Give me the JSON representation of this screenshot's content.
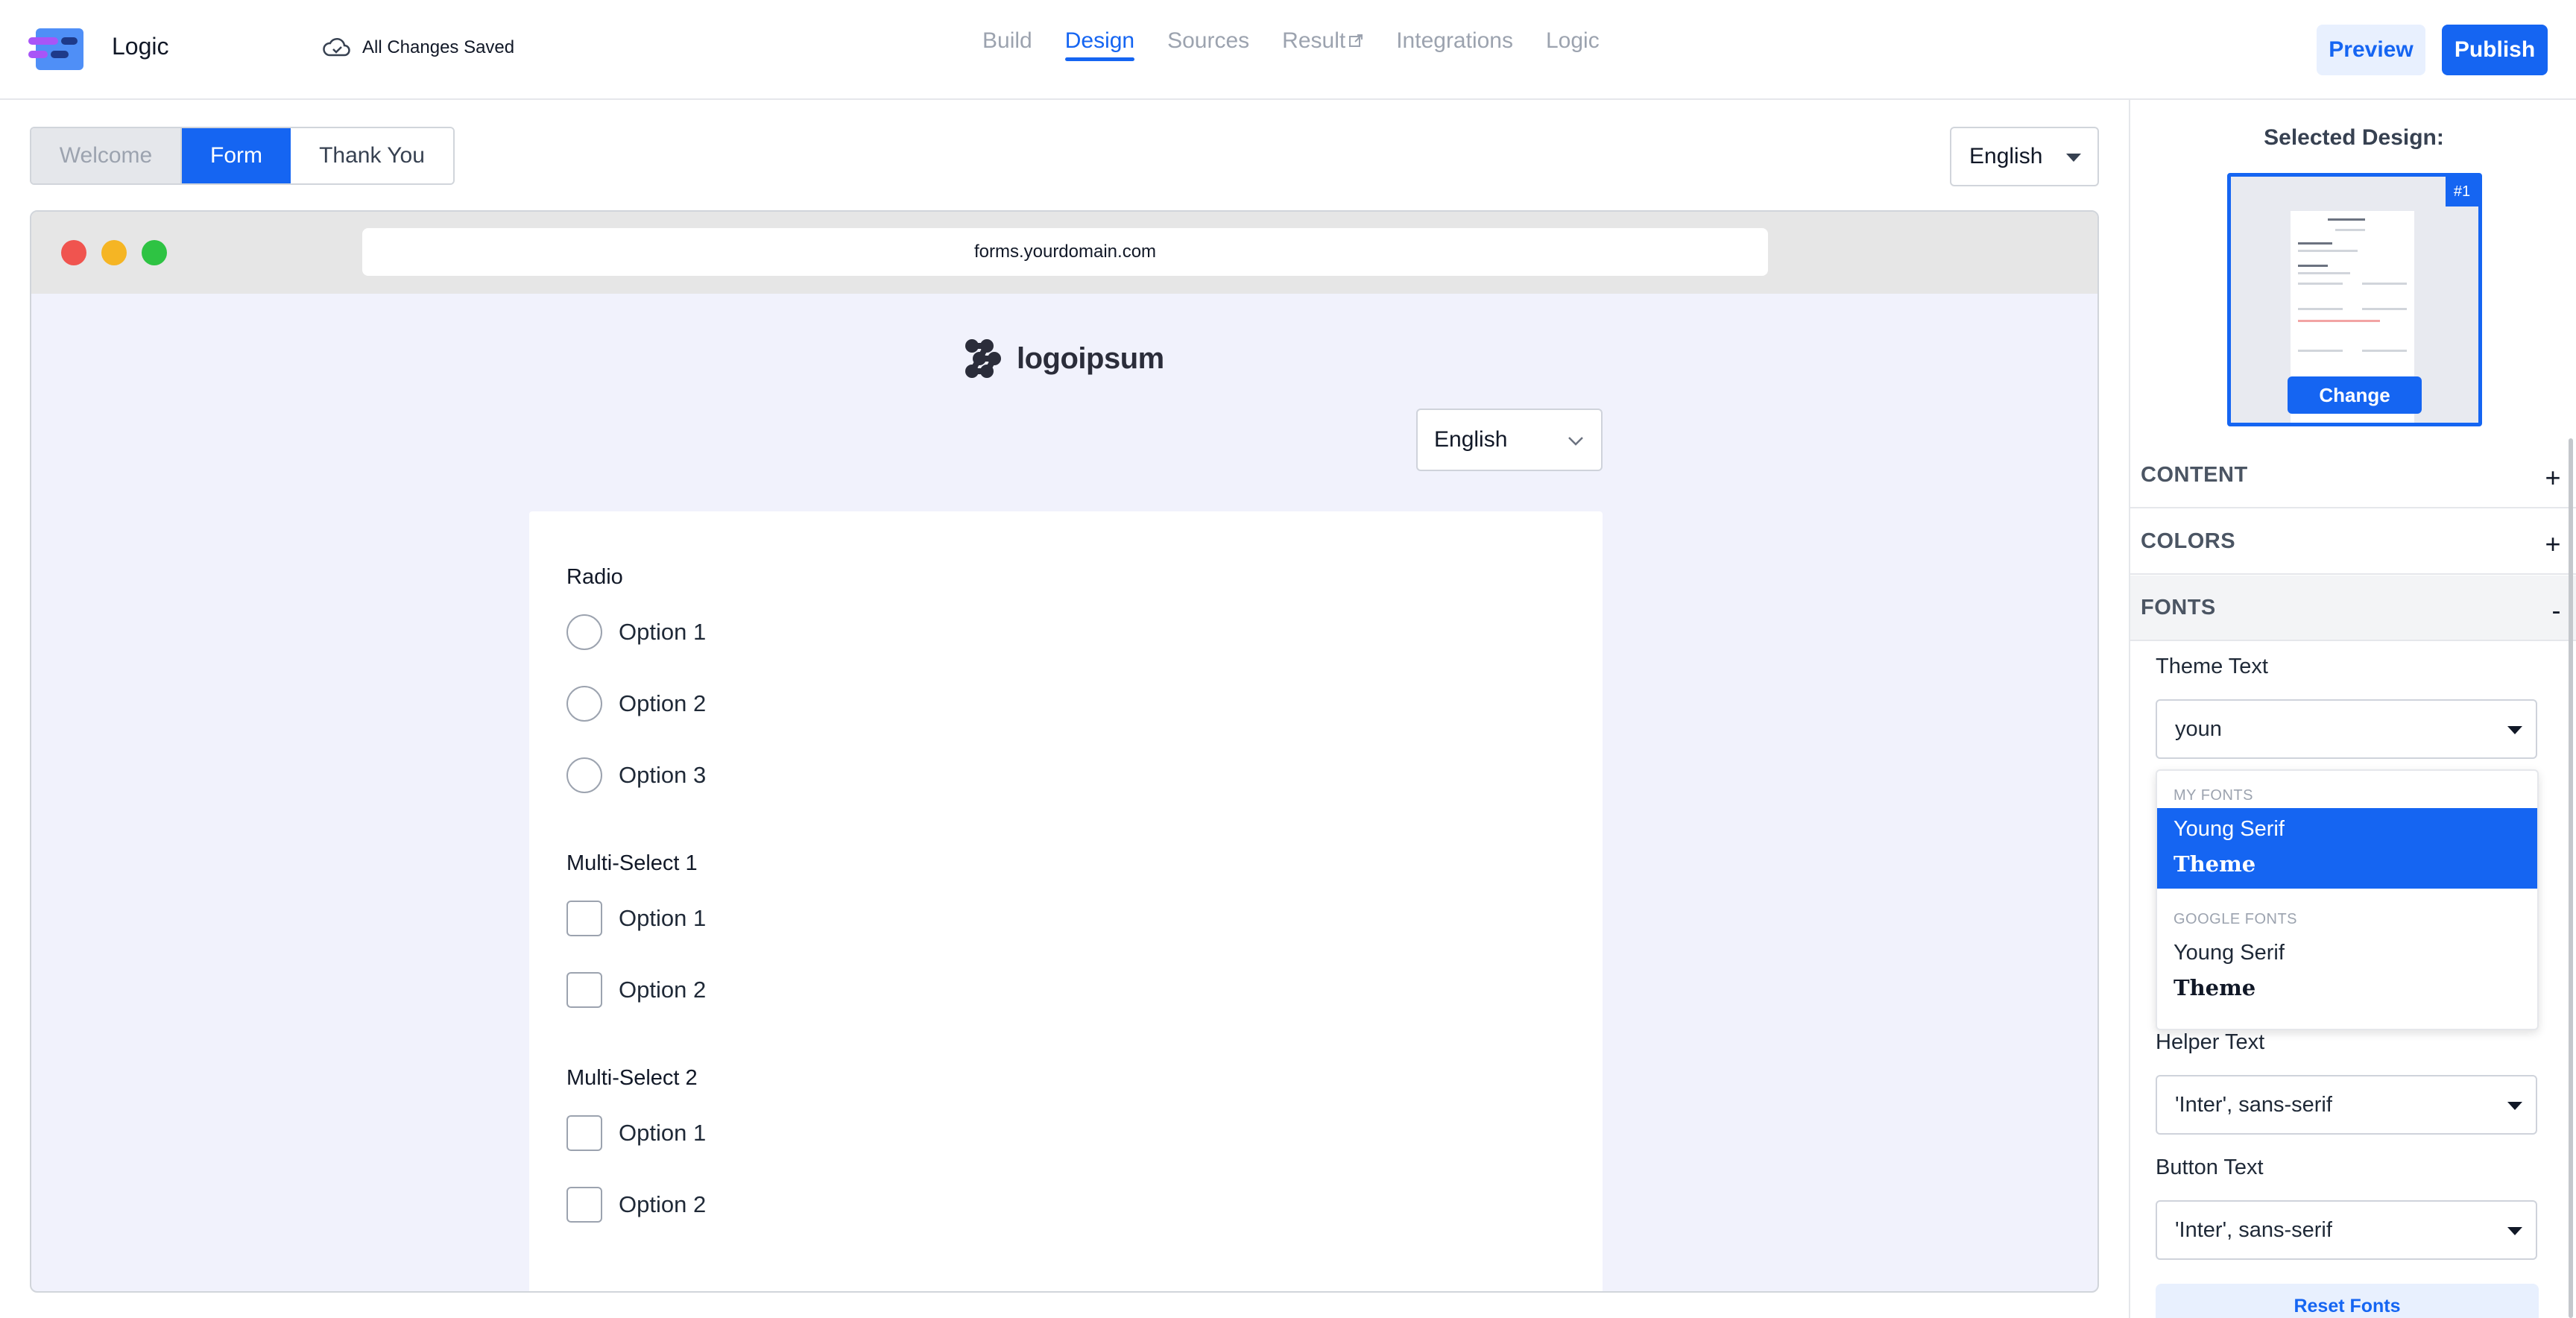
{
  "app": {
    "name": "Logic",
    "save_status": "All Changes Saved"
  },
  "nav": {
    "tabs": [
      {
        "label": "Build"
      },
      {
        "label": "Design"
      },
      {
        "label": "Sources"
      },
      {
        "label": "Result"
      },
      {
        "label": "Integrations"
      },
      {
        "label": "Logic"
      }
    ],
    "active": "Design"
  },
  "actions": {
    "preview": "Preview",
    "publish": "Publish"
  },
  "page_tabs": {
    "welcome": "Welcome",
    "form": "Form",
    "thanks": "Thank You"
  },
  "language": {
    "selected": "English"
  },
  "browser": {
    "url": "forms.yourdomain.com"
  },
  "form": {
    "logo_text": "logoipsum",
    "language": "English",
    "sections": [
      {
        "label": "Radio",
        "options": [
          "Option 1",
          "Option 2",
          "Option 3"
        ]
      },
      {
        "label": "Multi-Select 1",
        "options": [
          "Option 1",
          "Option 2"
        ]
      },
      {
        "label": "Multi-Select 2",
        "options": [
          "Option 1",
          "Option 2"
        ]
      }
    ]
  },
  "panel": {
    "selected_design_title": "Selected Design:",
    "thumb_badge": "#1",
    "thumb_change": "Change",
    "accordions": {
      "content": "CONTENT",
      "colors": "COLORS",
      "fonts": "FONTS"
    },
    "theme_text_label": "Theme Text",
    "theme_text_value": "youn",
    "dropdown": {
      "group_my": "MY FONTS",
      "group_google": "GOOGLE FONTS",
      "items": [
        {
          "name": "Young Serif",
          "sample": "Theme"
        },
        {
          "name": "Young Serif",
          "sample": "Theme"
        }
      ]
    },
    "helper_text_label": "Helper Text",
    "helper_text_value": "'Inter', sans-serif",
    "button_text_label": "Button Text",
    "button_text_value": "'Inter', sans-serif",
    "reset_fonts": "Reset Fonts"
  },
  "colors": {
    "accent": "#1565f2",
    "canvas": "#f1f2fc"
  }
}
